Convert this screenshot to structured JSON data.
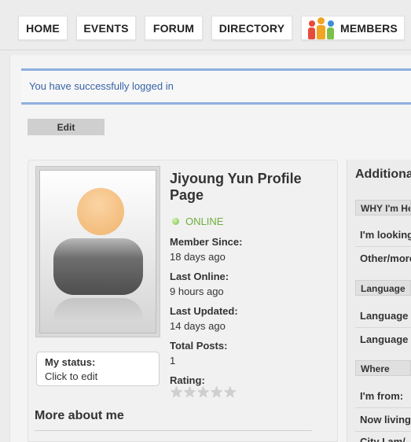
{
  "nav": {
    "items": [
      {
        "label": "HOME"
      },
      {
        "label": "EVENTS"
      },
      {
        "label": "FORUM"
      },
      {
        "label": "DIRECTORY"
      },
      {
        "label": "MEMBERS",
        "icon": "members-icon"
      }
    ]
  },
  "notice": {
    "text": "You have successfully logged in"
  },
  "edit_button": {
    "label": "Edit"
  },
  "profile": {
    "title": "Jiyoung Yun Profile Page",
    "online_status": "ONLINE",
    "member_since_label": "Member Since:",
    "member_since_value": "18 days ago",
    "last_online_label": "Last Online:",
    "last_online_value": "9 hours ago",
    "last_updated_label": "Last Updated:",
    "last_updated_value": "14 days ago",
    "total_posts_label": "Total Posts:",
    "total_posts_value": "1",
    "rating_label": "Rating:",
    "rating_value": 0,
    "rating_max": 5
  },
  "status": {
    "label": "My status:",
    "value": "Click to edit"
  },
  "more_about": {
    "title": "More about me"
  },
  "sidebar": {
    "title": "Additional",
    "sections": [
      {
        "heading": "WHY I'm Here",
        "rows": [
          "I'm looking",
          "Other/more"
        ]
      },
      {
        "heading": "Language",
        "rows": [
          "Language",
          "Language"
        ]
      },
      {
        "heading": "Where",
        "rows": [
          "I'm from:",
          "Now living",
          "City I am/"
        ]
      }
    ]
  },
  "colors": {
    "accent_blue": "#3a64a8",
    "notice_border": "#8fb0de",
    "online_green": "#6fae3c",
    "members_icon": [
      "#e84a3c",
      "#f2a423",
      "#3c8fd6",
      "#7cc04a"
    ]
  }
}
